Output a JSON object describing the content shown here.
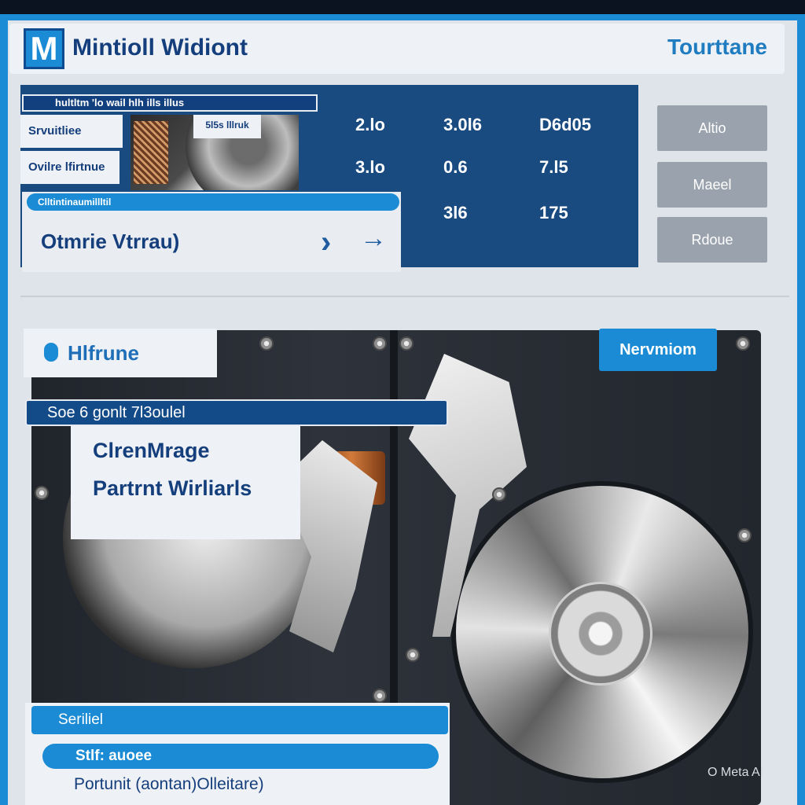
{
  "app": {
    "logo_letter": "M",
    "title": "Mintioll Widiont",
    "top_right": "Tourttane"
  },
  "top": {
    "header_strip": "hultltm 'lo wail   hlh ills illus",
    "side_labels": [
      "Srvuitliee",
      "Ovilre lfirtnue"
    ],
    "photo_tag": "5l5s lllruk",
    "stats": [
      [
        "2.lo",
        "3.0l6",
        "D6d05"
      ],
      [
        "3.lo",
        "0.6",
        "7.l5"
      ],
      [
        "",
        "3l6",
        "175"
      ]
    ],
    "sub_card": {
      "bar": "Clltintinaumillltil",
      "text": "Otmrie Vtrrau)"
    },
    "side_buttons": [
      "Altio",
      "Maeel",
      "Rdoue"
    ]
  },
  "lower": {
    "label": "Hlfrune",
    "badge": "Nervmiom",
    "bar": "Soe 6 gonlt  7l3oulel",
    "lines": [
      "ClrenMrage",
      "Partrnt Wirliarls"
    ]
  },
  "bottom": {
    "bar": "Seriliel",
    "pill": "Stlf: auoee",
    "text": "Portunit (aontan)Olleitare)"
  },
  "watermark": "O Meta AI"
}
